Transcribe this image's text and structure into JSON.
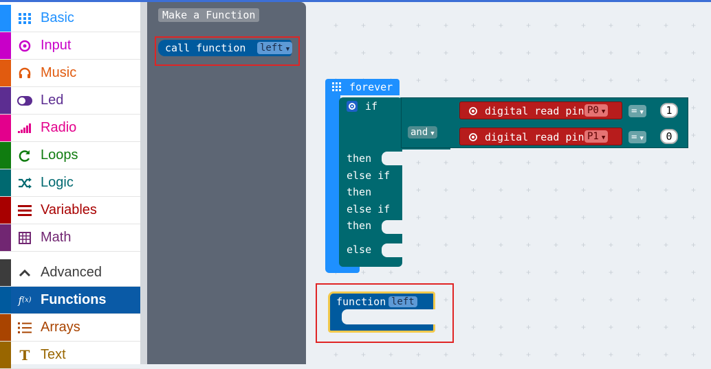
{
  "toolbox": {
    "categories": [
      {
        "label": "Basic",
        "icon": "grid-icon",
        "color": "#1e90ff"
      },
      {
        "label": "Input",
        "icon": "target-icon",
        "color": "#c800c8"
      },
      {
        "label": "Music",
        "icon": "headphones-icon",
        "color": "#e15b0f"
      },
      {
        "label": "Led",
        "icon": "toggle-icon",
        "color": "#5c2d91"
      },
      {
        "label": "Radio",
        "icon": "signal-icon",
        "color": "#e3008c"
      },
      {
        "label": "Loops",
        "icon": "loop-icon",
        "color": "#107c10"
      },
      {
        "label": "Logic",
        "icon": "shuffle-icon",
        "color": "#006970"
      },
      {
        "label": "Variables",
        "icon": "list-icon",
        "color": "#a80000"
      },
      {
        "label": "Math",
        "icon": "calculator-icon",
        "color": "#712672"
      }
    ],
    "advanced": [
      {
        "label": "Advanced",
        "icon": "chevron-up-icon",
        "color": "#3c3c3c"
      },
      {
        "label": "Functions",
        "icon": "function-icon",
        "color": "#005a9e"
      },
      {
        "label": "Arrays",
        "icon": "numbered-list-icon",
        "color": "#a94400"
      },
      {
        "label": "Text",
        "icon": "text-icon",
        "color": "#996600"
      }
    ]
  },
  "flyout": {
    "make_function": "Make a Function",
    "call_block": {
      "text": "call function",
      "name": "left"
    }
  },
  "workspace": {
    "forever": {
      "label": "forever"
    },
    "if_block": {
      "if": "if",
      "and": "and",
      "then": "then",
      "else_if": "else if",
      "else": "else"
    },
    "read1": {
      "text": "digital read pin",
      "pin": "P0",
      "op": "=",
      "value": "1"
    },
    "read2": {
      "text": "digital read pin",
      "pin": "P1",
      "op": "=",
      "value": "0"
    },
    "function_block": {
      "text": "function",
      "name": "left"
    }
  }
}
